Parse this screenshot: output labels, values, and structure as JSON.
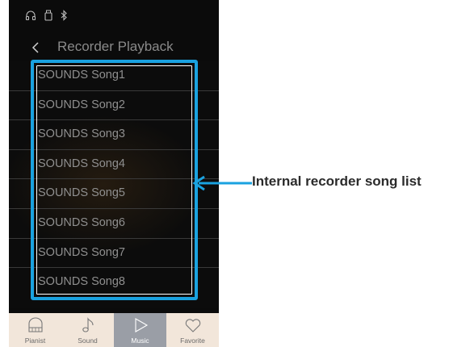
{
  "screen": {
    "title": "Recorder Playback",
    "status_icons": [
      "headphones-icon",
      "usb-drive-icon",
      "bluetooth-icon"
    ]
  },
  "songs": [
    {
      "label": "SOUNDS Song1"
    },
    {
      "label": "SOUNDS Song2"
    },
    {
      "label": "SOUNDS Song3"
    },
    {
      "label": "SOUNDS Song4"
    },
    {
      "label": "SOUNDS Song5"
    },
    {
      "label": "SOUNDS Song6"
    },
    {
      "label": "SOUNDS Song7"
    },
    {
      "label": "SOUNDS Song8"
    }
  ],
  "tabs": [
    {
      "label": "Pianist",
      "icon": "piano-icon",
      "active": false
    },
    {
      "label": "Sound",
      "icon": "music-note-icon",
      "active": false
    },
    {
      "label": "Music",
      "icon": "play-icon",
      "active": true
    },
    {
      "label": "Favorite",
      "icon": "heart-icon",
      "active": false
    }
  ],
  "callout": {
    "label": "Internal recorder song list"
  },
  "colors": {
    "highlight": "#1aa2e0",
    "tab_bar": "#f2e6da",
    "tab_active": "#9a9ea6"
  }
}
